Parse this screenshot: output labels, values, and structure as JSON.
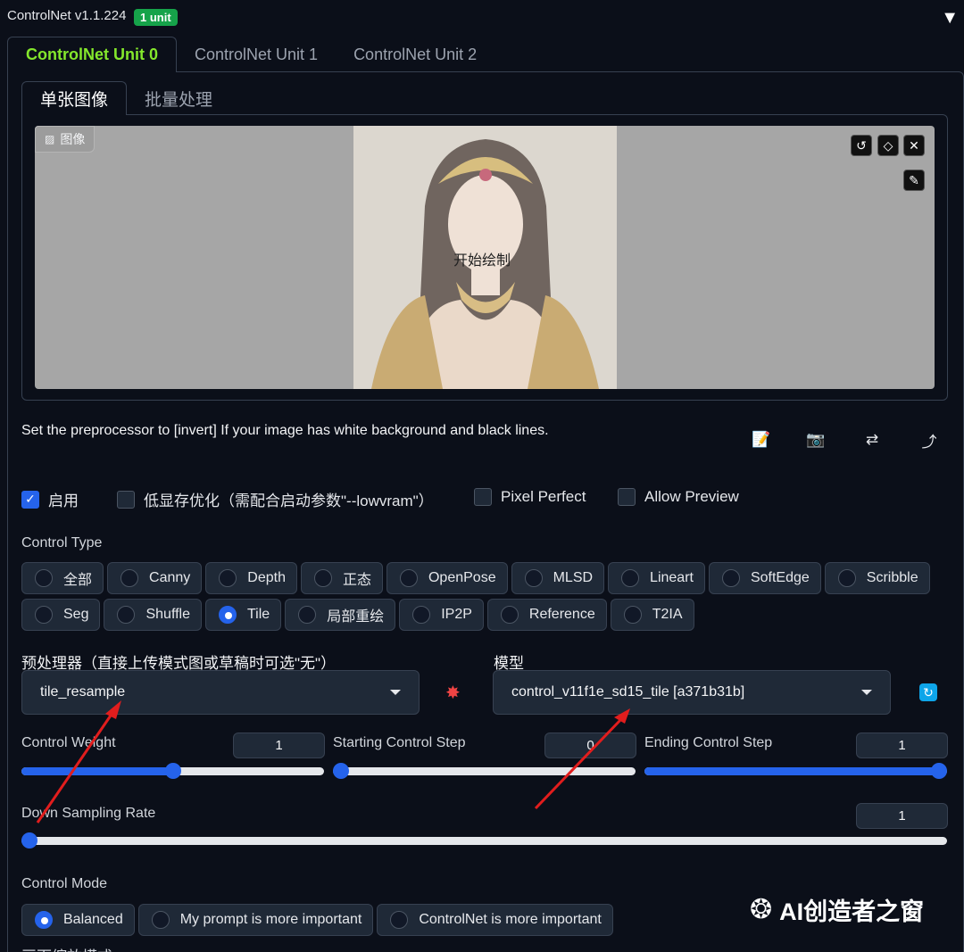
{
  "header": {
    "title": "ControlNet v1.1.224",
    "badge": "1 unit",
    "collapse_icon": "▼"
  },
  "unit_tabs": [
    "ControlNet Unit 0",
    "ControlNet Unit 1",
    "ControlNet Unit 2"
  ],
  "inner_tabs": [
    "单张图像",
    "批量处理"
  ],
  "canvas": {
    "label": "图像",
    "center_text": "开始绘制"
  },
  "hint": "Set the preprocessor to [invert] If your image has white background and black lines.",
  "checkboxes": {
    "enable": "启用",
    "lowvram": "低显存优化（需配合启动参数\"--lowvram\"）",
    "pixel_perfect": "Pixel Perfect",
    "allow_preview": "Allow Preview"
  },
  "control_type": {
    "label": "Control Type",
    "row1": [
      "全部",
      "Canny",
      "Depth",
      "正态",
      "OpenPose",
      "MLSD",
      "Lineart",
      "SoftEdge",
      "Scribble"
    ],
    "row2": [
      "Seg",
      "Shuffle",
      "Tile",
      "局部重绘",
      "IP2P",
      "Reference",
      "T2IA"
    ],
    "selected": "Tile"
  },
  "preprocessor": {
    "label": "预处理器（直接上传模式图或草稿时可选\"无\"）",
    "value": "tile_resample"
  },
  "model": {
    "label": "模型",
    "value": "control_v11f1e_sd15_tile [a371b31b]"
  },
  "sliders": {
    "weight": {
      "label": "Control Weight",
      "value": "1",
      "fraction": 0.5
    },
    "start": {
      "label": "Starting Control Step",
      "value": "0",
      "fraction": 0.0
    },
    "end": {
      "label": "Ending Control Step",
      "value": "1",
      "fraction": 1.0
    },
    "down": {
      "label": "Down Sampling Rate",
      "value": "1",
      "fraction": 0.0
    }
  },
  "control_mode": {
    "label": "Control Mode",
    "options": [
      "Balanced",
      "My prompt is more important",
      "ControlNet is more important"
    ],
    "selected": "Balanced"
  },
  "resize_label": "画面缩放模式",
  "watermark": "AI创造者之窗",
  "colors": {
    "accent": "#2563eb",
    "tab_active": "#84e72c",
    "badge": "#16a34a",
    "arrow": "#e11d1d"
  }
}
